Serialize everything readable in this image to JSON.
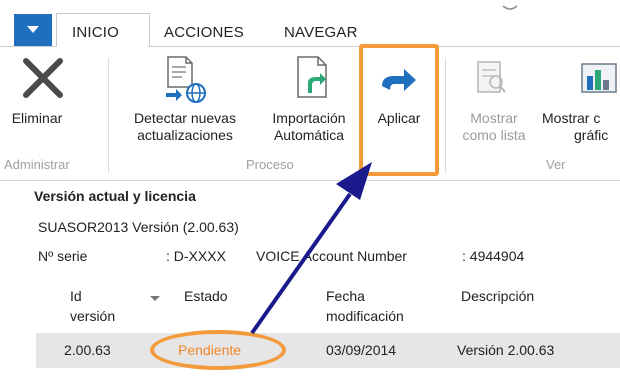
{
  "ribbon": {
    "tabs": [
      {
        "label": "INICIO",
        "active": true
      },
      {
        "label": "ACCIONES",
        "active": false
      },
      {
        "label": "NAVEGAR",
        "active": false
      }
    ],
    "buttons": {
      "eliminar": {
        "label": "Eliminar",
        "icon": "delete-x-icon"
      },
      "detectar": {
        "label_line1": "Detectar nuevas",
        "label_line2": "actualizaciones",
        "icon": "detect-updates-icon"
      },
      "importacion": {
        "label_line1": "Importación",
        "label_line2": "Automática",
        "icon": "auto-import-icon"
      },
      "aplicar": {
        "label": "Aplicar",
        "icon": "apply-arrow-icon"
      },
      "mostrar_lista": {
        "label_line1": "Mostrar",
        "label_line2": "como lista",
        "icon": "list-view-icon",
        "disabled": true
      },
      "mostrar_grafico": {
        "label_line1": "Mostrar c",
        "label_line2": "gráfic",
        "icon": "chart-view-icon"
      }
    },
    "groups": {
      "administrar": "Administrar",
      "proceso": "Proceso",
      "ver": "Ver"
    }
  },
  "info": {
    "title": "Versión actual y licencia",
    "product": "SUASOR2013 Versión (2.00.63)",
    "serie_label": "Nº serie",
    "serie_value": ": D-XXXX",
    "account_label": "VOICE Account Number",
    "account_value": ": 4944904"
  },
  "table": {
    "headers": {
      "id_line1": "Id",
      "id_line2": "versión",
      "estado": "Estado",
      "fecha_line1": "Fecha",
      "fecha_line2": "modificación",
      "descripcion": "Descripción"
    },
    "rows": [
      {
        "id": "2.00.63",
        "estado": "Pendiente",
        "fecha": "03/09/2014",
        "descripcion": "Versión 2.00.63"
      }
    ]
  },
  "colors": {
    "accent_blue": "#1f6fbf",
    "highlight_orange": "#f39a3a",
    "arrow_navy": "#1a1a8c",
    "status_orange": "#f0862a"
  }
}
